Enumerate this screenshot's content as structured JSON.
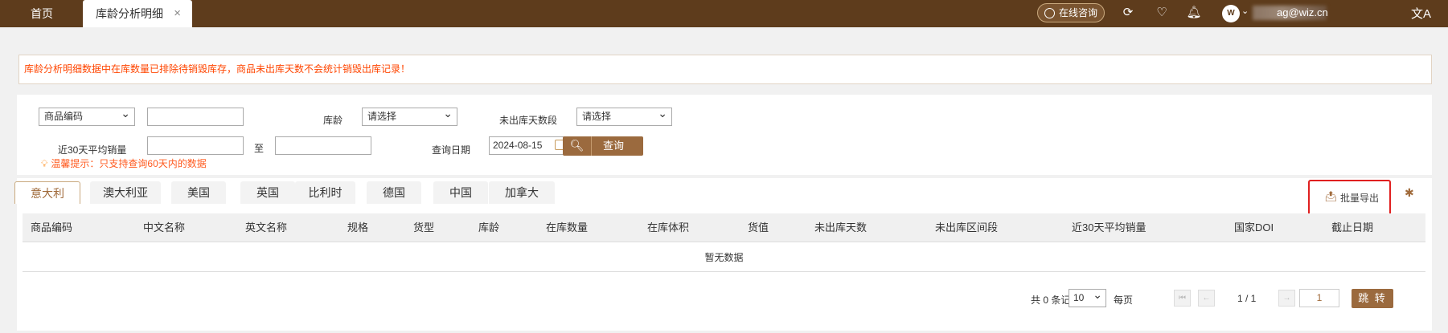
{
  "topbar": {
    "home_tab": "首页",
    "active_tab": "库龄分析明细",
    "close_glyph": "×",
    "consult_label": "在线咨询",
    "user_email_suffix": "cn",
    "avatar_text": "W",
    "icons": [
      "refresh-icon",
      "heart-icon",
      "bell-icon",
      "user-avatar",
      "translate-icon"
    ]
  },
  "notice": "库龄分析明细数据中在库数量已排除待销毁库存，商品未出库天数不会统计销毁出库记录！",
  "filter": {
    "code_type_select": "商品编码",
    "code_input": "",
    "age_label": "库龄",
    "age_select": "请选择",
    "days_label": "未出库天数段",
    "days_select": "请选择",
    "avg_sales_label": "近30天平均销量",
    "avg_from": "",
    "to_label": "至",
    "avg_to": "",
    "query_date_label": "查询日期",
    "query_date": "2024-08-15",
    "query_button": "查询",
    "tip": "温馨提示：只支持查询60天内的数据"
  },
  "country_tabs": [
    "意大利",
    "澳大利亚",
    "美国",
    "英国",
    "比利时",
    "德国",
    "中国",
    "加拿大"
  ],
  "active_country_index": 0,
  "export_label": "批量导出",
  "table": {
    "columns": [
      "商品编码",
      "中文名称",
      "英文名称",
      "规格",
      "货型",
      "库龄",
      "在库数量",
      "在库体积",
      "货值",
      "未出库天数",
      "未出库区间段",
      "近30天平均销量",
      "国家DOI",
      "截止日期"
    ],
    "empty_text": "暂无数据"
  },
  "pagination": {
    "total_text": "共 0 条记录",
    "page_size": "10",
    "per_page_label": "每页",
    "page_indicator": "1 / 1",
    "page_input": "1",
    "go_button": "跳 转"
  },
  "colors": {
    "brand": "#5e3c1c",
    "accent": "#9b6a3e",
    "warning": "#ff4500",
    "highlight_border": "#e02020"
  }
}
